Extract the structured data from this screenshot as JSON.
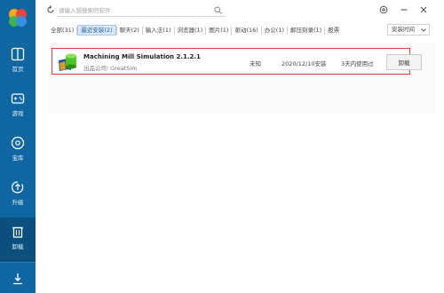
{
  "sidebar": {
    "items": [
      {
        "label": "首页",
        "icon": "home-icon"
      },
      {
        "label": "游戏",
        "icon": "gamepad-icon"
      },
      {
        "label": "宝库",
        "icon": "disc-icon"
      },
      {
        "label": "升级",
        "icon": "upgrade-icon"
      },
      {
        "label": "卸载",
        "icon": "trash-icon",
        "active": true
      }
    ],
    "bottom_icon": "download-icon",
    "accent": "#0f66a0",
    "active_bg": "#0a4f7e"
  },
  "search": {
    "placeholder": "请输入想搜索的软件"
  },
  "window_controls": [
    "settings-icon",
    "minimize-icon",
    "close-icon"
  ],
  "tabs": [
    {
      "label": "全部(31)"
    },
    {
      "label": "最近安装(2)",
      "active": true
    },
    {
      "label": "聊天(2)"
    },
    {
      "label": "输入法(1)"
    },
    {
      "label": "浏览器(1)"
    },
    {
      "label": "图片(1)"
    },
    {
      "label": "驱动(16)"
    },
    {
      "label": "办公(1)"
    },
    {
      "label": "解压刻录(1)"
    },
    {
      "label": "股票"
    }
  ],
  "sort": {
    "label": "安装时间"
  },
  "apps": [
    {
      "name": "Machining Mill Simulation 2.1.2.1",
      "publisher": "出品公司: GreatSim",
      "size": "未知",
      "install_date": "2020/12/10安装",
      "last_used": "3天内使用过",
      "action": "卸载"
    }
  ],
  "colors": {
    "highlight_border": "#e23c3c",
    "tab_active_bg": "#dbe9f6"
  }
}
